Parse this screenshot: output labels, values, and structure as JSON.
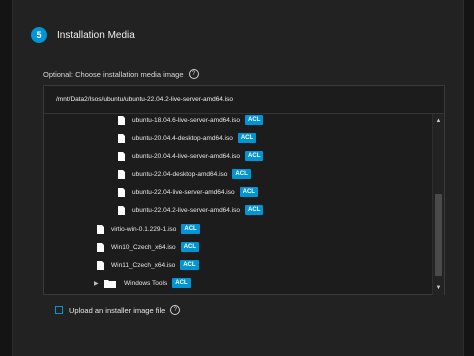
{
  "step": {
    "number": "5",
    "title": "Installation Media"
  },
  "media_section": {
    "label": "Optional: Choose installation media image"
  },
  "explorer": {
    "path": "/mnt/Data2/Isos/ubuntu/ubuntu-22.04.2-live-server-amd64.iso",
    "badge": "ACL",
    "items": [
      {
        "name": "ubuntu-18.04.6-live-server-amd64.iso",
        "type": "file"
      },
      {
        "name": "ubuntu-20.04.4-desktop-amd64.iso",
        "type": "file"
      },
      {
        "name": "ubuntu-20.04.4-live-server-amd64.iso",
        "type": "file"
      },
      {
        "name": "ubuntu-22.04-desktop-amd64.iso",
        "type": "file"
      },
      {
        "name": "ubuntu-22.04-live-server-amd64.iso",
        "type": "file"
      },
      {
        "name": "ubuntu-22.04.2-live-server-amd64.iso",
        "type": "file"
      },
      {
        "name": "virtio-win-0.1.229-1.iso",
        "type": "file"
      },
      {
        "name": "Win10_Czech_x64.iso",
        "type": "file"
      },
      {
        "name": "Win11_Czech_x64.iso",
        "type": "file"
      },
      {
        "name": "Windows Tools",
        "type": "folder"
      }
    ]
  },
  "upload": {
    "label": "Upload an installer image file"
  },
  "colors": {
    "accent": "#0095d5",
    "background": "#222222"
  }
}
